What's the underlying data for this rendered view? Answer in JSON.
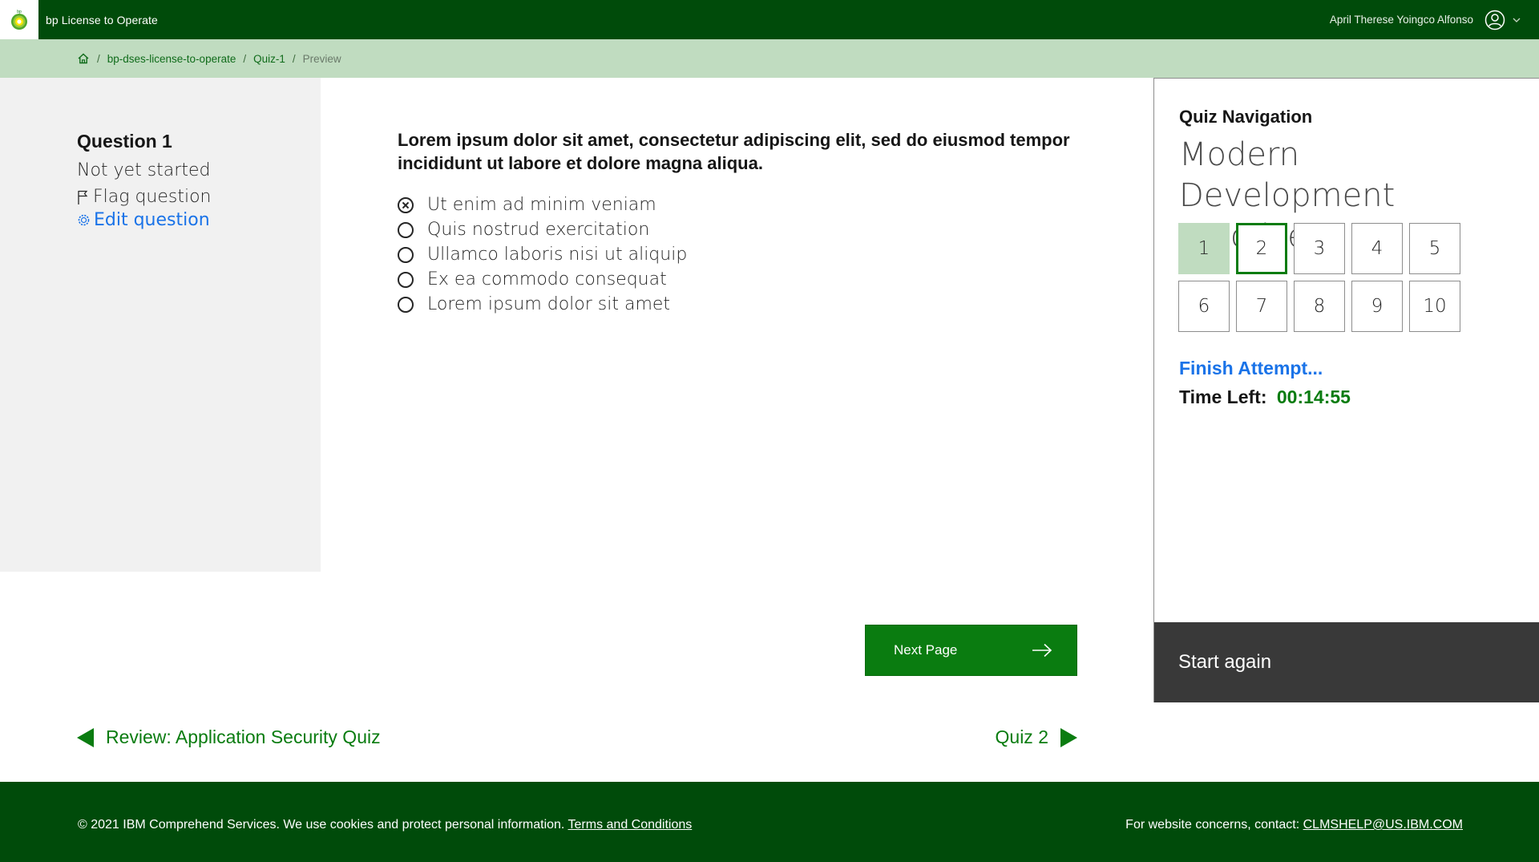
{
  "header": {
    "app_title": "bp License to Operate",
    "logo_text": "bp",
    "user_name": "April Therese Yoingco Alfonso"
  },
  "breadcrumb": {
    "items": [
      "bp-dses-license-to-operate",
      "Quiz-1"
    ],
    "current": "Preview"
  },
  "question_info": {
    "title": "Question 1",
    "status": "Not yet started",
    "flag_label": "Flag question",
    "edit_label": "Edit question"
  },
  "question": {
    "text": "Lorem ipsum dolor sit amet, consectetur adipiscing elit, sed do eiusmod tempor incididunt ut labore et dolore magna aliqua.",
    "answers": [
      "Ut enim ad minim veniam",
      "Quis nostrud exercitation",
      "Ullamco laboris nisi ut aliquip",
      "Ex ea commodo consequat",
      "Lorem ipsum dolor sit amet"
    ]
  },
  "actions": {
    "next_page": "Next Page",
    "prev_activity": "Review: Application Security Quiz",
    "next_activity": "Quiz 2"
  },
  "quiz_navigation": {
    "heading": "Quiz Navigation",
    "course": "Modern Development Practices",
    "pages": [
      "1",
      "2",
      "3",
      "4",
      "5",
      "6",
      "7",
      "8",
      "9",
      "10"
    ],
    "finish_label": "Finish Attempt...",
    "time_label": "Time Left:",
    "time_value": "00:14:55",
    "start_again": "Start again"
  },
  "footer": {
    "copyright": "© 2021 IBM Comprehend Services. We use cookies and protect personal information.",
    "terms": "Terms and Conditions",
    "contact_label": "For website concerns, contact:",
    "contact_email": "CLMSHELP@US.IBM.COM"
  },
  "colors": {
    "brand_dark_green": "#004b0a",
    "accent_green": "#0a7c10",
    "light_green": "#c0dcc0",
    "link_blue": "#1a73e8",
    "dark_gray": "#393939"
  }
}
